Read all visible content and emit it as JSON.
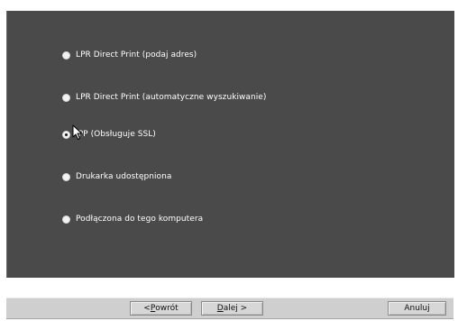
{
  "options": [
    {
      "label": "LPR Direct Print (podaj adres)",
      "selected": false
    },
    {
      "label": "LPR Direct Print (automatyczne wyszukiwanie)",
      "selected": false
    },
    {
      "label": "IPP (Obsługuje SSL)",
      "selected": true
    },
    {
      "label": "Drukarka udostępniona",
      "selected": false
    },
    {
      "label": "Podłączona do tego komputera",
      "selected": false
    }
  ],
  "buttons": {
    "back_prefix": "< ",
    "back_underlined": "P",
    "back_rest": "owrót",
    "next_underlined": "D",
    "next_rest": "alej >",
    "cancel": "Anuluj"
  }
}
